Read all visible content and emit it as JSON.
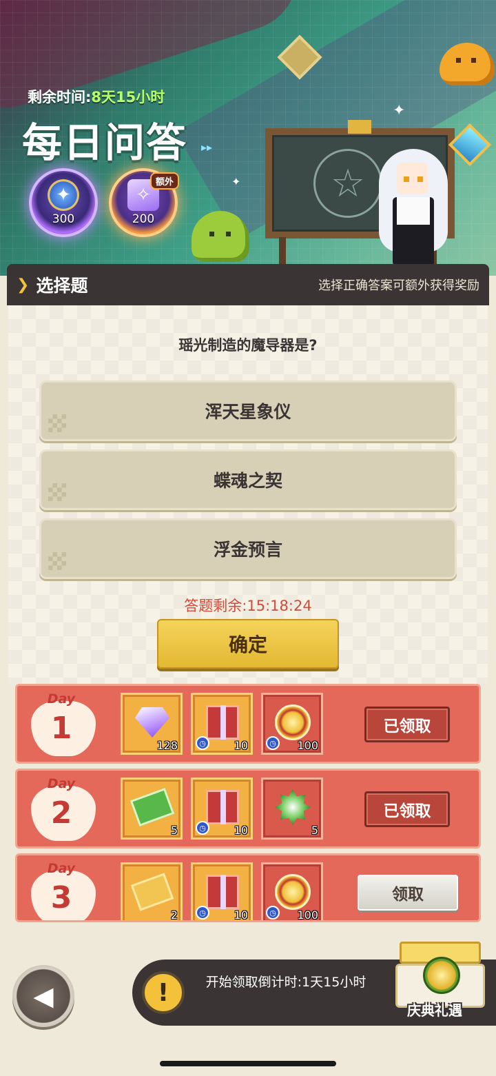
{
  "banner": {
    "remaining_label": "剩余时间:",
    "remaining_value": "8天15小时",
    "title": "每日问答",
    "arrows": "▸▸",
    "orb_rewards": [
      {
        "icon": "star-coin-icon",
        "amount": "300"
      },
      {
        "icon": "purple-gem-icon",
        "amount": "200"
      }
    ],
    "extra_badge": "额外"
  },
  "section": {
    "title": "选择题",
    "subtitle": "选择正确答案可额外获得奖励"
  },
  "quiz": {
    "question": "瑶光制造的魔导器是?",
    "options": [
      "浑天星象仪",
      "蝶魂之契",
      "浮金预言"
    ],
    "countdown": "答题剩余:15:18:24",
    "confirm_label": "确定"
  },
  "days": [
    {
      "label": "Day",
      "number": "1",
      "rewards": [
        {
          "icon": "purple-gem-icon",
          "count": "128",
          "timed": false
        },
        {
          "icon": "purple-gift-box-icon",
          "count": "10",
          "timed": true
        },
        {
          "icon": "red-gold-coin-icon",
          "count": "100",
          "timed": true
        }
      ],
      "button": "已领取",
      "status": "claimed"
    },
    {
      "label": "Day",
      "number": "2",
      "rewards": [
        {
          "icon": "green-ticket-icon",
          "count": "5",
          "timed": false
        },
        {
          "icon": "purple-gift-box-icon",
          "count": "10",
          "timed": true
        },
        {
          "icon": "green-medal-icon",
          "count": "5",
          "timed": false
        }
      ],
      "button": "已领取",
      "status": "claimed"
    },
    {
      "label": "Day",
      "number": "3",
      "rewards": [
        {
          "icon": "gold-book-icon",
          "count": "2",
          "timed": false
        },
        {
          "icon": "purple-gift-box-icon",
          "count": "10",
          "timed": true
        },
        {
          "icon": "red-gold-coin-icon",
          "count": "100",
          "timed": true
        }
      ],
      "button": "领取",
      "status": "available"
    }
  ],
  "bottom": {
    "countdown_text": "开始领取倒计时:1天15小时",
    "celebration_label": "庆典礼遇"
  },
  "colors": {
    "accent_red": "#e5695b",
    "accent_gold": "#f3c23a",
    "dark_panel": "#3a3434",
    "countdown_red": "#d24a3a",
    "time_green": "#b6ff6a"
  }
}
